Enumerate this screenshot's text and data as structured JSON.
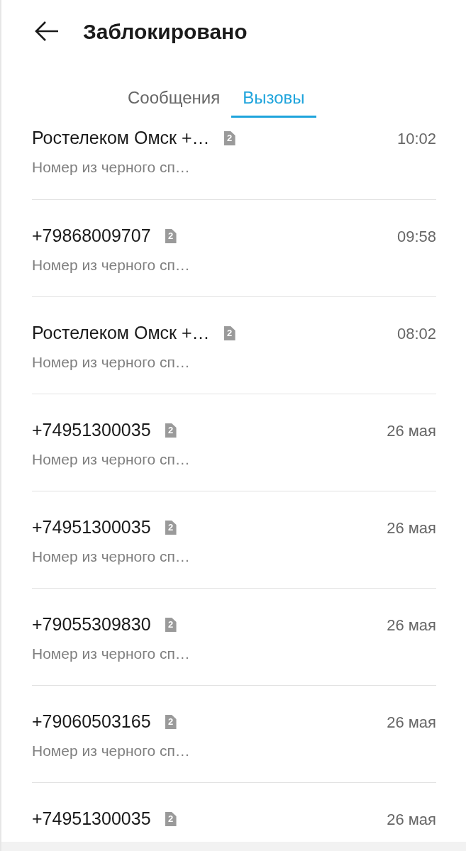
{
  "header": {
    "title": "Заблокировано"
  },
  "tabs": [
    {
      "label": "Сообщения",
      "selected": false
    },
    {
      "label": "Вызовы",
      "selected": true
    }
  ],
  "calls": [
    {
      "name": "Ростелеком Омск +…",
      "sim": "2",
      "time": "10:02",
      "note": "Номер из черного сп…"
    },
    {
      "name": "+79868009707",
      "sim": "2",
      "time": "09:58",
      "note": "Номер из черного сп…"
    },
    {
      "name": "Ростелеком Омск +…",
      "sim": "2",
      "time": "08:02",
      "note": "Номер из черного сп…"
    },
    {
      "name": "+74951300035",
      "sim": "2",
      "time": "26 мая",
      "note": "Номер из черного сп…"
    },
    {
      "name": "+74951300035",
      "sim": "2",
      "time": "26 мая",
      "note": "Номер из черного сп…"
    },
    {
      "name": "+79055309830",
      "sim": "2",
      "time": "26 мая",
      "note": "Номер из черного сп…"
    },
    {
      "name": "+79060503165",
      "sim": "2",
      "time": "26 мая",
      "note": "Номер из черного сп…"
    },
    {
      "name": "+74951300035",
      "sim": "2",
      "time": "26 мая"
    }
  ]
}
